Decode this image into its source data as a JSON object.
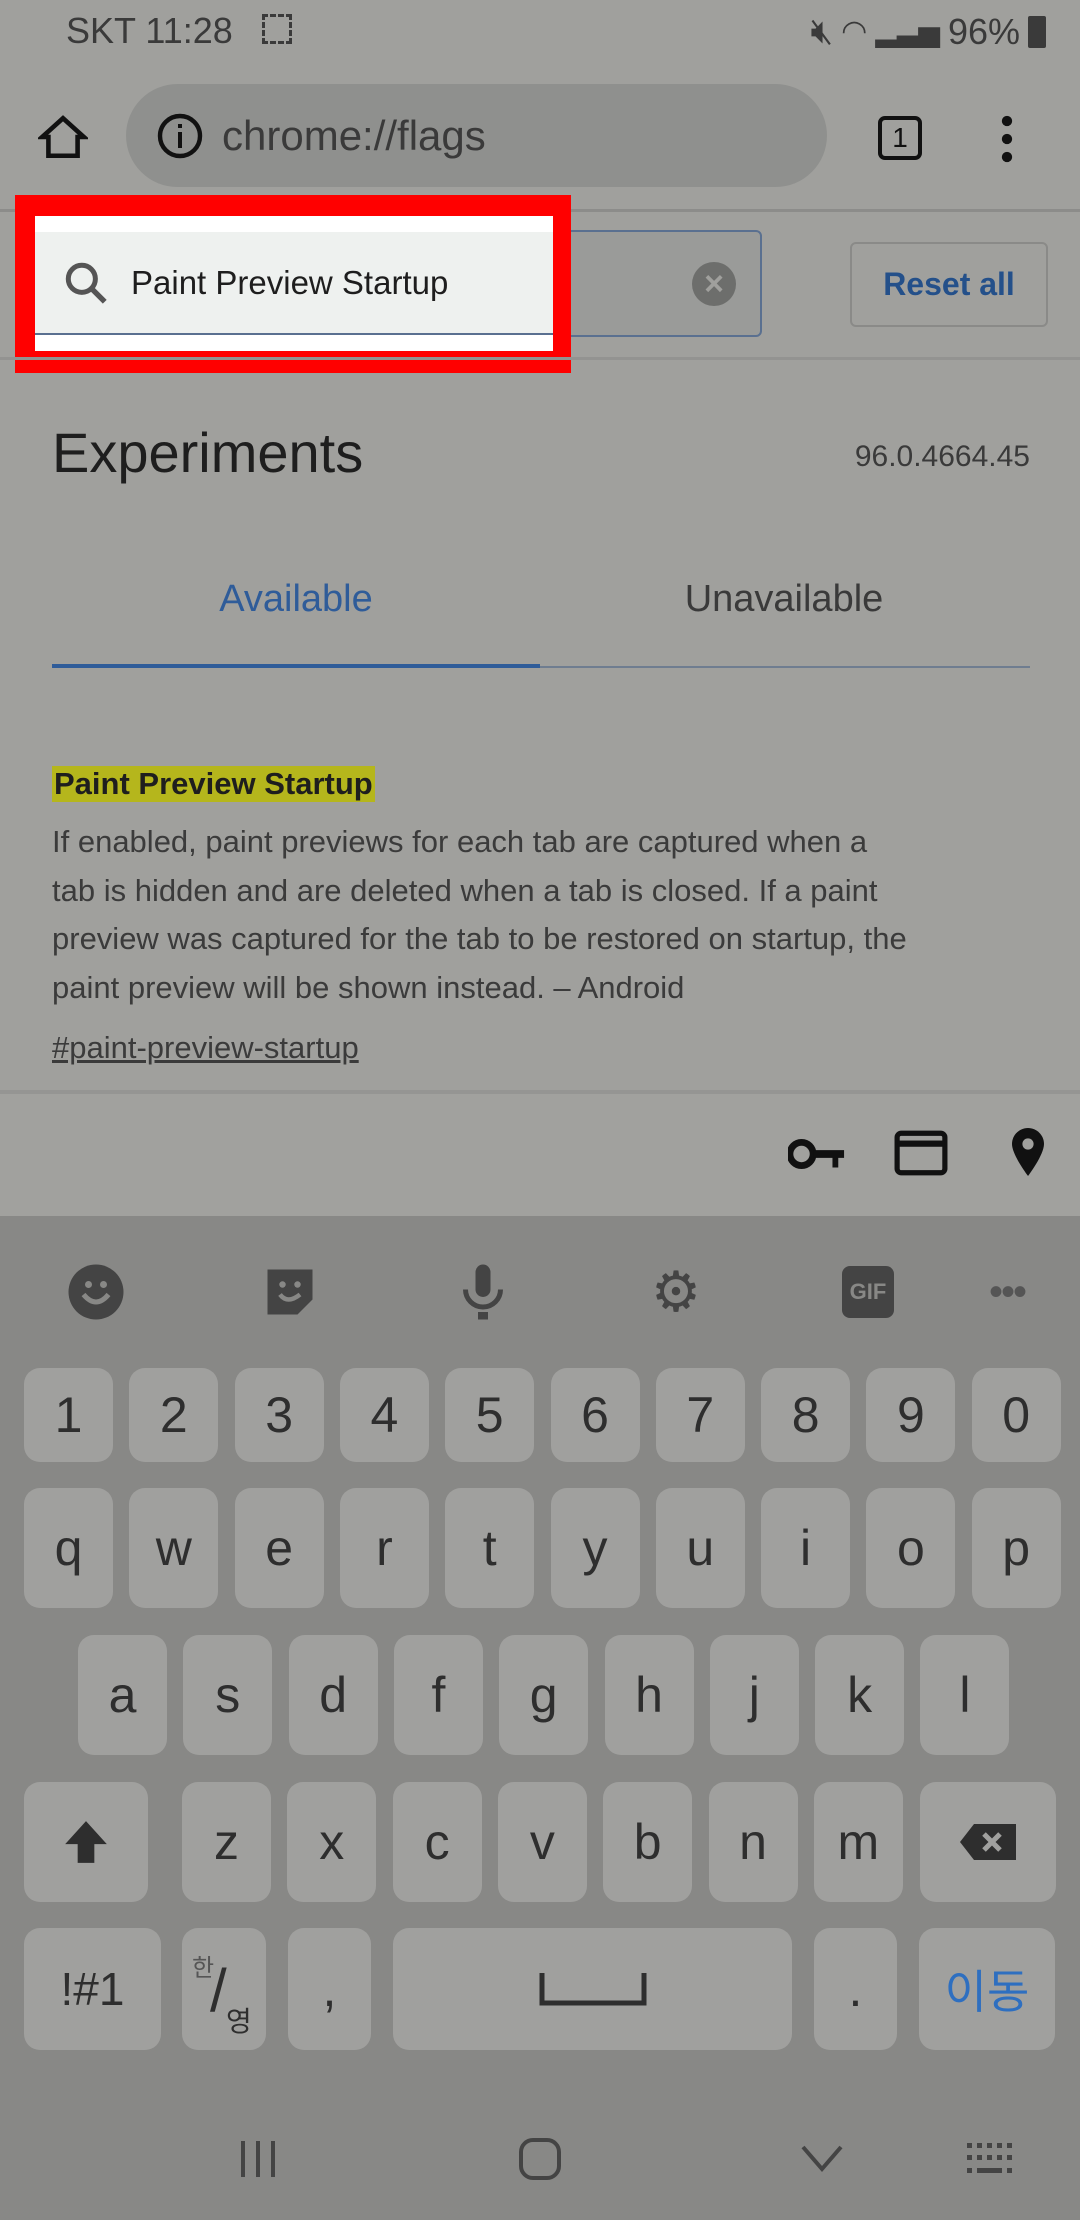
{
  "status_bar": {
    "carrier_time": "SKT 11:28",
    "battery": "96%",
    "icons": [
      "screenshot-icon",
      "mute-icon",
      "wifi-icon",
      "signal-icon",
      "battery-icon"
    ]
  },
  "toolbar": {
    "url": "chrome://flags",
    "tab_count": "1",
    "icons": [
      "home-icon",
      "info-icon",
      "tab-switcher-icon",
      "more-vert-icon"
    ]
  },
  "search": {
    "value": "Paint Preview Startup",
    "reset_label": "Reset all"
  },
  "page": {
    "title": "Experiments",
    "version": "96.0.4664.45"
  },
  "tabs": [
    {
      "label": "Available",
      "active": true
    },
    {
      "label": "Unavailable",
      "active": false
    }
  ],
  "flag": {
    "name": "Paint Preview Startup",
    "description_lines": [
      "If enabled, paint previews for each tab are captured when a",
      "tab is hidden and are deleted when a tab is closed. If a paint",
      "preview was captured for the tab to be restored on startup, the",
      "paint preview will be shown instead. – Android"
    ],
    "link": "#paint-preview-startup"
  },
  "autofill_icons": [
    "key-icon",
    "credit-card-icon",
    "location-pin-icon"
  ],
  "keyboard": {
    "toolbar_icons": [
      "emoji-icon",
      "sticker-icon",
      "microphone-icon",
      "settings-icon",
      "gif-icon",
      "more-horiz-icon"
    ],
    "gif_label": "GIF",
    "rows": [
      [
        "1",
        "2",
        "3",
        "4",
        "5",
        "6",
        "7",
        "8",
        "9",
        "0"
      ],
      [
        "q",
        "w",
        "e",
        "r",
        "t",
        "y",
        "u",
        "i",
        "o",
        "p"
      ],
      [
        "a",
        "s",
        "d",
        "f",
        "g",
        "h",
        "j",
        "k",
        "l"
      ],
      [
        "z",
        "x",
        "c",
        "v",
        "b",
        "n",
        "m"
      ]
    ],
    "symbols_key": "!#1",
    "lang_key_top": "한",
    "lang_key_bottom": "영",
    "comma": ",",
    "period": ".",
    "go_key": "이동",
    "accent": "#2e6fc0"
  },
  "nav_icons": [
    "recents-icon",
    "home-icon",
    "back-icon",
    "keyboard-switch-icon"
  ]
}
